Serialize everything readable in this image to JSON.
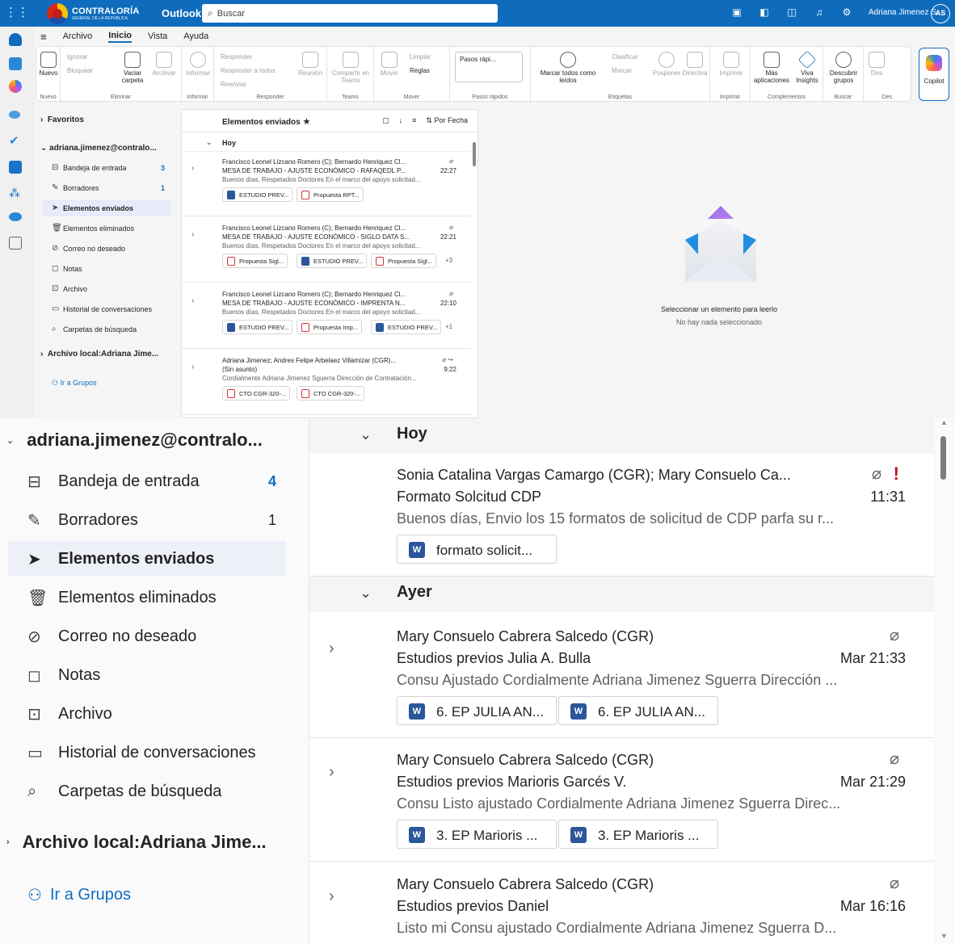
{
  "titlebar": {
    "org_line1": "CONTRALORÍA",
    "org_line2": "GENERAL DE LA REPÚBLICA",
    "app_name": "Outlook",
    "search_placeholder": "Buscar",
    "user_name": "Adriana Jimenez S...",
    "user_initials": "AS",
    "brand_color": "#0f6cbd"
  },
  "menu": {
    "tabs": [
      "Archivo",
      "Inicio",
      "Vista",
      "Ayuda"
    ],
    "active_tab": "Inicio"
  },
  "ribbon": {
    "groups": [
      "Nuevo",
      "Eliminar",
      "Informar",
      "Responder",
      "Teams",
      "Mover",
      "Pasos rápidos",
      "Etiquetas",
      "Imprimir",
      "Complementos",
      "Buscar",
      "Des"
    ],
    "new_label": "Nuevo",
    "ignore": "Ignorar",
    "block": "Bloquear",
    "empty_folder": "Vaciar carpeta",
    "archive": "Archivar",
    "report": "Informar",
    "reply": "Responder",
    "reply_all": "Responder a todos",
    "forward": "Reenviar",
    "meeting": "Reunión",
    "share_teams": "Compartir en Teams",
    "move": "Mover",
    "sweep": "Limpiar",
    "rules": "Reglas",
    "quick_steps": "Pasos rápi...",
    "mark_all_read": "Marcar todos como leídos",
    "classify": "Clasificar",
    "flag": "Marcar",
    "snooze": "Posponer",
    "policy": "Directiva",
    "print": "Imprimir",
    "more_apps": "Más aplicaciones",
    "viva": "Viva Insights",
    "discover_groups": "Descubrir grupos",
    "des": "Des",
    "copilot": "Copilot"
  },
  "small_folders": {
    "favorites": "Favoritos",
    "account": "adriana.jimenez@contralo...",
    "items": [
      {
        "label": "Bandeja de entrada",
        "count": "3",
        "icon": "inbox-icon"
      },
      {
        "label": "Borradores",
        "count": "1",
        "icon": "drafts-icon"
      },
      {
        "label": "Elementos enviados",
        "count": "",
        "icon": "sent-icon"
      },
      {
        "label": "Elementos eliminados",
        "count": "",
        "icon": "trash-icon"
      },
      {
        "label": "Correo no deseado",
        "count": "",
        "icon": "junk-icon"
      },
      {
        "label": "Notas",
        "count": "",
        "icon": "notes-icon"
      },
      {
        "label": "Archivo",
        "count": "",
        "icon": "archive-icon"
      },
      {
        "label": "Historial de conversaciones",
        "count": "",
        "icon": "history-icon"
      },
      {
        "label": "Carpetas de búsqueda",
        "count": "",
        "icon": "search-folder-icon"
      }
    ],
    "local_archive": "Archivo local:Adriana Jime...",
    "go_groups": "Ir a Grupos"
  },
  "small_list": {
    "title": "Elementos enviados",
    "sort": "Por Fecha",
    "section": "Hoy",
    "messages": [
      {
        "from": "Francisco Leonel Lizcano Romero (C); Bernardo Henriquez Cl...",
        "subject": "MESA DE TRABAJO - AJUSTE ECONÓMICO - RAFAQEDL P...",
        "time": "22:27",
        "preview": "Buenos días, Respetados Doctores En el marco del apoyo solicitad...",
        "attachments": [
          {
            "name": "ESTUDIO PREV...",
            "type": "word"
          },
          {
            "name": "Propuesta RPT...",
            "type": "pdf"
          }
        ],
        "more": ""
      },
      {
        "from": "Francisco Leonel Lizcano Romero (C); Bernardo Henriquez Cl...",
        "subject": "MESA DE TRABAJO - AJUSTE ECONÓMICO - SIGLO DATA S...",
        "time": "22:21",
        "preview": "Buenos días, Respetados Doctores En el marco del apoyo solicitad...",
        "attachments": [
          {
            "name": "Propuesta Sigl...",
            "type": "pdf"
          },
          {
            "name": "ESTUDIO PREV...",
            "type": "word"
          },
          {
            "name": "Propuesta Sigl...",
            "type": "pdf"
          }
        ],
        "more": "+3"
      },
      {
        "from": "Francisco Leonel Lizcano Romero (C); Bernardo Henriquez Cl...",
        "subject": "MESA DE TRABAJO - AJUSTE ECONÓMICO - IMPRENTA N...",
        "time": "22:10",
        "preview": "Buenos días, Respetados Doctores En el marco del apoyo solicitad...",
        "attachments": [
          {
            "name": "ESTUDIO PREV...",
            "type": "word"
          },
          {
            "name": "Propuesta Imp...",
            "type": "pdf"
          },
          {
            "name": "ESTUDIO PREV...",
            "type": "word"
          }
        ],
        "more": "+1"
      },
      {
        "from": "Adriana Jimenez; Andres Felipe Arbelaez Villamizar (CGR)...",
        "subject": "(Sin asunto)",
        "time": "9:22",
        "preview": "Cordialmente Adriana Jimenez Sguerra Dirección de Contratación...",
        "attachments": [
          {
            "name": "CTO CGR-320-...",
            "type": "pdf"
          },
          {
            "name": "CTO CGR-320-...",
            "type": "pdf"
          }
        ],
        "more": ""
      }
    ]
  },
  "reading_pane": {
    "title": "Seleccionar un elemento para leerlo",
    "subtitle": "No hay nada seleccionado"
  },
  "big_folders": {
    "account": "adriana.jimenez@contralo...",
    "items": [
      {
        "label": "Bandeja de entrada",
        "count": "4"
      },
      {
        "label": "Borradores",
        "count": "1"
      },
      {
        "label": "Elementos enviados",
        "count": ""
      },
      {
        "label": "Elementos eliminados",
        "count": ""
      },
      {
        "label": "Correo no deseado",
        "count": ""
      },
      {
        "label": "Notas",
        "count": ""
      },
      {
        "label": "Archivo",
        "count": ""
      },
      {
        "label": "Historial de conversaciones",
        "count": ""
      },
      {
        "label": "Carpetas de búsqueda",
        "count": ""
      }
    ],
    "local_archive": "Archivo local:Adriana Jime...",
    "go_groups": "Ir a Grupos"
  },
  "big_list": {
    "section_today": "Hoy",
    "section_yesterday": "Ayer",
    "messages": [
      {
        "from": "Sonia Catalina Vargas Camargo (CGR); Mary Consuelo Ca...",
        "subject": "Formato Solcitud CDP",
        "time": "11:31",
        "preview": "Buenos días, Envio los 15 formatos de solicitud de CDP parfa su r...",
        "attachments": [
          "formato solicit..."
        ],
        "important": true
      },
      {
        "from": "Mary Consuelo Cabrera Salcedo (CGR)",
        "subject": "Estudios previos Julia A. Bulla",
        "time": "Mar 21:33",
        "preview": "Consu Ajustado Cordialmente Adriana Jimenez Sguerra Dirección ...",
        "attachments": [
          "6. EP JULIA AN...",
          "6. EP JULIA AN..."
        ],
        "important": false
      },
      {
        "from": "Mary Consuelo Cabrera Salcedo (CGR)",
        "subject": "Estudios previos Marioris Garcés V.",
        "time": "Mar 21:29",
        "preview": "Consu Listo ajustado Cordialmente Adriana Jimenez Sguerra Direc...",
        "attachments": [
          "3. EP Marioris ...",
          "3. EP Marioris ..."
        ],
        "important": false
      },
      {
        "from": "Mary Consuelo Cabrera Salcedo (CGR)",
        "subject": "Estudios previos Daniel",
        "time": "Mar 16:16",
        "preview": "Listo mi Consu ajustado Cordialmente Adriana Jimenez Sguerra D...",
        "attachments": [],
        "important": false
      }
    ]
  }
}
